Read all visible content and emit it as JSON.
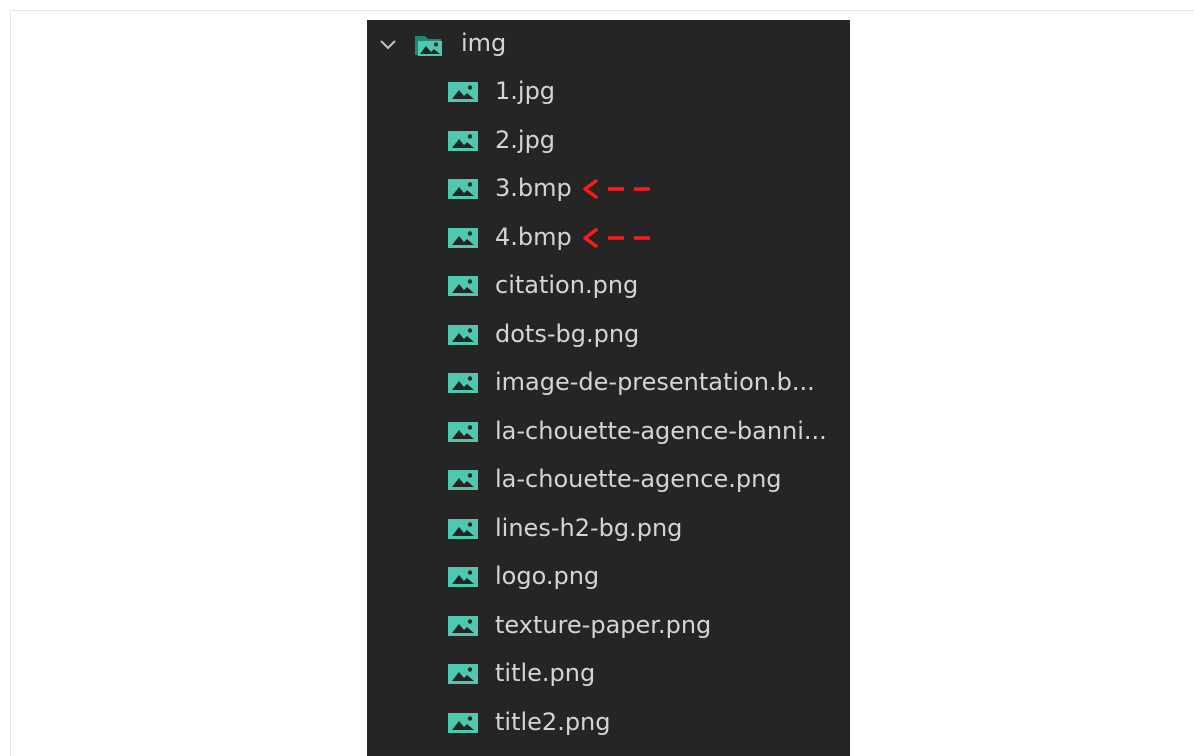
{
  "explorer": {
    "folder": {
      "name": "img",
      "expanded": true
    },
    "files": [
      {
        "name": "1.jpg"
      },
      {
        "name": "2.jpg"
      },
      {
        "name": "3.bmp",
        "highlighted": true
      },
      {
        "name": "4.bmp",
        "highlighted": true
      },
      {
        "name": "citation.png"
      },
      {
        "name": "dots-bg.png"
      },
      {
        "name": "image-de-presentation.b..."
      },
      {
        "name": "la-chouette-agence-banni..."
      },
      {
        "name": "la-chouette-agence.png"
      },
      {
        "name": "lines-h2-bg.png"
      },
      {
        "name": "logo.png"
      },
      {
        "name": "texture-paper.png"
      },
      {
        "name": "title.png"
      },
      {
        "name": "title2.png"
      }
    ],
    "colors": {
      "background": "#252526",
      "text": "#d4d4d4",
      "icon": "#4ec9b0",
      "annotation": "#ff1a1a"
    }
  }
}
